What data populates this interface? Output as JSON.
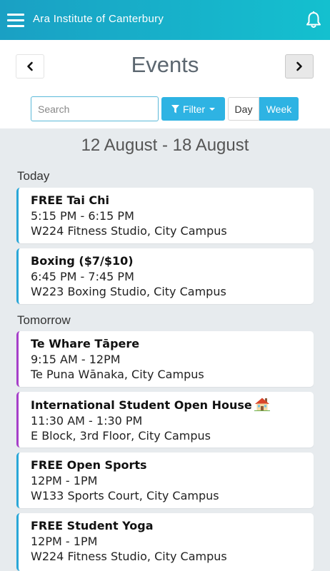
{
  "header": {
    "title": "Ara Institute of Canterbury",
    "menu_icon": "hamburger-menu-icon",
    "notification_icon": "bell-icon",
    "gradient_start": "#1aa0c4",
    "gradient_end": "#14c0cf"
  },
  "page": {
    "title": "Events",
    "prev_icon": "chevron-left-icon",
    "next_icon": "chevron-right-icon"
  },
  "controls": {
    "search_placeholder": "Search",
    "search_value": "",
    "filter_label": "Filter",
    "filter_icon": "funnel-icon",
    "view_options": [
      "Day",
      "Week"
    ],
    "selected_view": "Week",
    "accent_color": "#2eb3e3"
  },
  "date_range": "12 August - 18 August",
  "sections": [
    {
      "label": "Today",
      "events": [
        {
          "title": "FREE Tai Chi",
          "time": "5:15 PM - 6:15 PM",
          "location": "W224 Fitness Studio, City Campus",
          "color": "#2aa7d8"
        },
        {
          "title": "Boxing ($7/$10)",
          "time": "6:45 PM - 7:45 PM",
          "location": "W223 Boxing Studio, City Campus",
          "color": "#2aa7d8"
        }
      ]
    },
    {
      "label": "Tomorrow",
      "events": [
        {
          "title": "Te Whare Tāpere",
          "time": "9:15 AM - 12PM",
          "location": "Te Puna Wānaka, City Campus",
          "color": "#a63fc9"
        },
        {
          "title": "International Student Open House",
          "title_icon": "house-emoji-icon",
          "time": "11:30 AM - 1:30 PM",
          "location": "E Block, 3rd Floor, City Campus",
          "color": "#a63fc9"
        },
        {
          "title": "FREE Open Sports",
          "time": "12PM - 1PM",
          "location": "W133 Sports Court, City Campus",
          "color": "#2aa7d8"
        },
        {
          "title": "FREE Student Yoga",
          "time": "12PM - 1PM",
          "location": "W224 Fitness Studio, City Campus",
          "color": "#2aa7d8"
        }
      ]
    }
  ]
}
